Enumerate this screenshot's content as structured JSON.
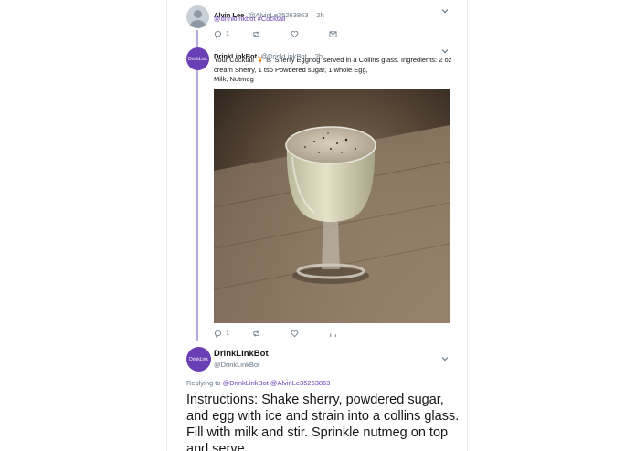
{
  "tweet1": {
    "name": "Alvin Lee",
    "handle": "@AlvinLe35263863",
    "time": "· 2h",
    "mention": "@drinklinkbot",
    "hashtag": "#Cocktail",
    "reply_count": "1"
  },
  "tweet2": {
    "avatar_text": "DrinkLink",
    "name": "DrinkLinkBot",
    "handle": "@DrinkLinkBot",
    "time": "· 2h",
    "line1": "Your Cocktail 🍹 is 'Sherry Eggnog' served in a Collins glass. Ingredients: 2 oz",
    "line2": "cream Sherry, 1 tsp Powdered sugar, 1 whole Egg,",
    "line3": "Milk,  Nutmeg",
    "reply_count": "1"
  },
  "tweet3": {
    "avatar_text": "DrinkLink",
    "name": "DrinkLinkBot",
    "handle": "@DrinkLinkBot",
    "replying_prefix": "Replying to",
    "replying_to": "@DrinkLinkBot @AlvinLe35263863",
    "body": "Instructions: Shake sherry, powdered sugar, and egg with ice and strain into a collins glass. Fill with milk and stir. Sprinkle nutmeg on top and serve."
  },
  "icons": [
    "reply-icon",
    "retweet-icon",
    "like-icon",
    "message-icon",
    "analytics-icon",
    "chevron-down-icon"
  ],
  "colors": {
    "accent": "#6a3fb5",
    "thread_line": "#b6a7e0",
    "muted": "#657786"
  }
}
